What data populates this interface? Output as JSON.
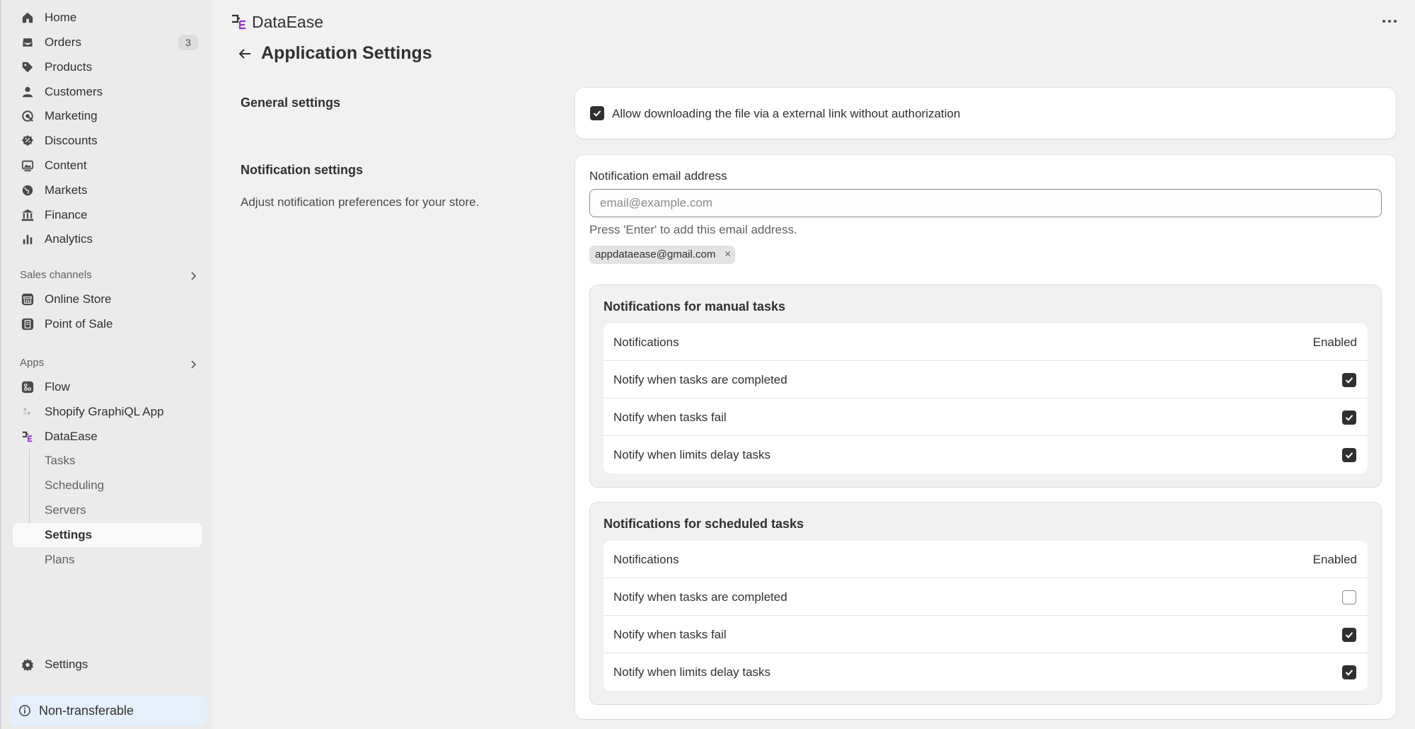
{
  "sidebar": {
    "items": [
      {
        "label": "Home",
        "icon": "home-icon"
      },
      {
        "label": "Orders",
        "icon": "inbox-icon",
        "badge": "3"
      },
      {
        "label": "Products",
        "icon": "tag-icon"
      },
      {
        "label": "Customers",
        "icon": "person-icon"
      },
      {
        "label": "Marketing",
        "icon": "target-icon"
      },
      {
        "label": "Discounts",
        "icon": "discount-icon"
      },
      {
        "label": "Content",
        "icon": "image-icon"
      },
      {
        "label": "Markets",
        "icon": "globe-icon"
      },
      {
        "label": "Finance",
        "icon": "bank-icon"
      },
      {
        "label": "Analytics",
        "icon": "bar-chart-icon"
      }
    ],
    "sales_channels_label": "Sales channels",
    "sales_channels": [
      {
        "label": "Online Store",
        "icon": "store-icon"
      },
      {
        "label": "Point of Sale",
        "icon": "pos-icon"
      }
    ],
    "apps_label": "Apps",
    "apps": [
      {
        "label": "Flow",
        "icon": "flow-icon"
      },
      {
        "label": "Shopify GraphiQL App",
        "icon": "graphiql-icon"
      },
      {
        "label": "DataEase",
        "icon": "dataease-icon"
      }
    ],
    "app_subitems": [
      "Tasks",
      "Scheduling",
      "Servers",
      "Settings",
      "Plans"
    ],
    "active_subitem": "Settings",
    "settings_label": "Settings",
    "status_label": "Non-transferable"
  },
  "header": {
    "brand": "DataEase",
    "title": "Application Settings"
  },
  "general": {
    "title": "General settings",
    "allow_download_label": "Allow downloading the file via a external link without authorization",
    "allow_download_checked": true
  },
  "notification": {
    "title": "Notification settings",
    "description": "Adjust notification preferences for your store.",
    "email_label": "Notification email address",
    "email_placeholder": "email@example.com",
    "email_hint": "Press 'Enter' to add this email address.",
    "emails": [
      "appdataease@gmail.com"
    ],
    "manual": {
      "title": "Notifications for manual tasks",
      "col_notifications": "Notifications",
      "col_enabled": "Enabled",
      "rows": [
        {
          "label": "Notify when tasks are completed",
          "checked": true
        },
        {
          "label": "Notify when tasks fail",
          "checked": true
        },
        {
          "label": "Notify when limits delay tasks",
          "checked": true
        }
      ]
    },
    "scheduled": {
      "title": "Notifications for scheduled tasks",
      "col_notifications": "Notifications",
      "col_enabled": "Enabled",
      "rows": [
        {
          "label": "Notify when tasks are completed",
          "checked": false
        },
        {
          "label": "Notify when tasks fail",
          "checked": true
        },
        {
          "label": "Notify when limits delay tasks",
          "checked": true
        }
      ]
    }
  },
  "colors": {
    "brand_purple": "#9b30d9",
    "checkbox_fill": "#303030",
    "status_bg": "#e6f0fa"
  }
}
